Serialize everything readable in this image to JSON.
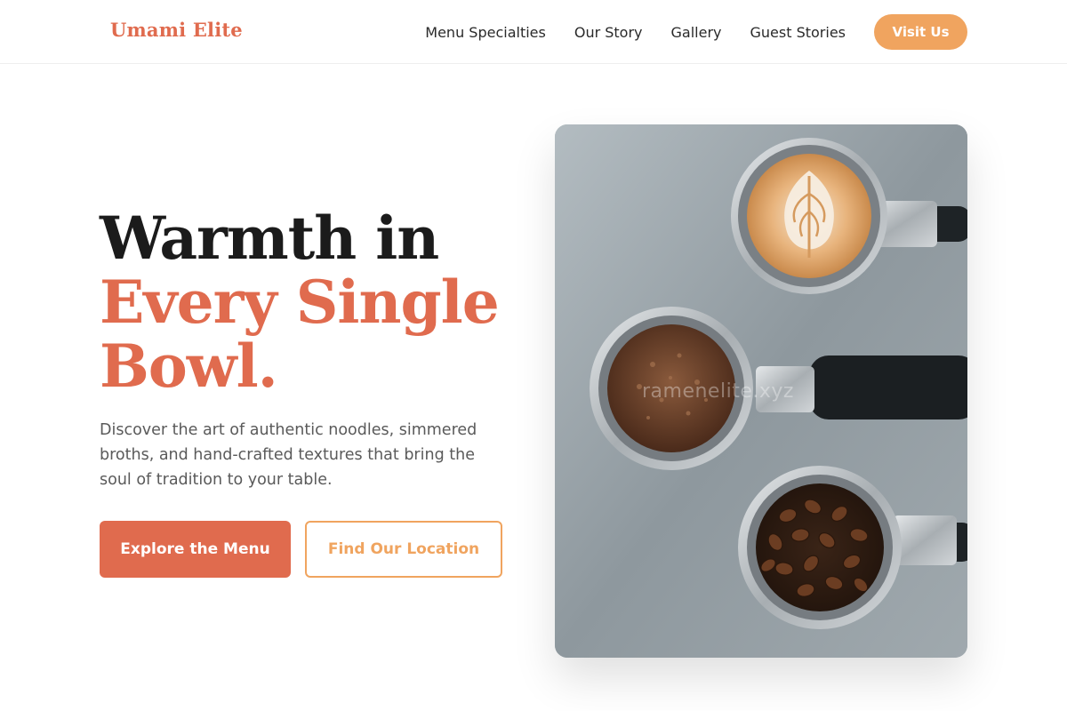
{
  "brand": {
    "name": "Umami Elite",
    "accent_color": "#e06b4e",
    "secondary_color": "#f0a45f"
  },
  "nav": {
    "links": [
      {
        "label": "Menu Specialties"
      },
      {
        "label": "Our Story"
      },
      {
        "label": "Gallery"
      },
      {
        "label": "Guest Stories"
      }
    ],
    "cta_label": "Visit Us"
  },
  "hero": {
    "title_line1": "Warmth in",
    "title_accent_line1": "Every Single",
    "title_accent_line2": "Bowl.",
    "description": "Discover the art of authentic noodles, simmered broths, and hand-crafted textures that bring the soul of tradition to your table.",
    "primary_button": "Explore the Menu",
    "secondary_button": "Find Our Location",
    "image": {
      "subject": "three espresso portafilters: latte art, ground coffee, coffee beans",
      "watermark": "ramenelite.xyz"
    }
  }
}
